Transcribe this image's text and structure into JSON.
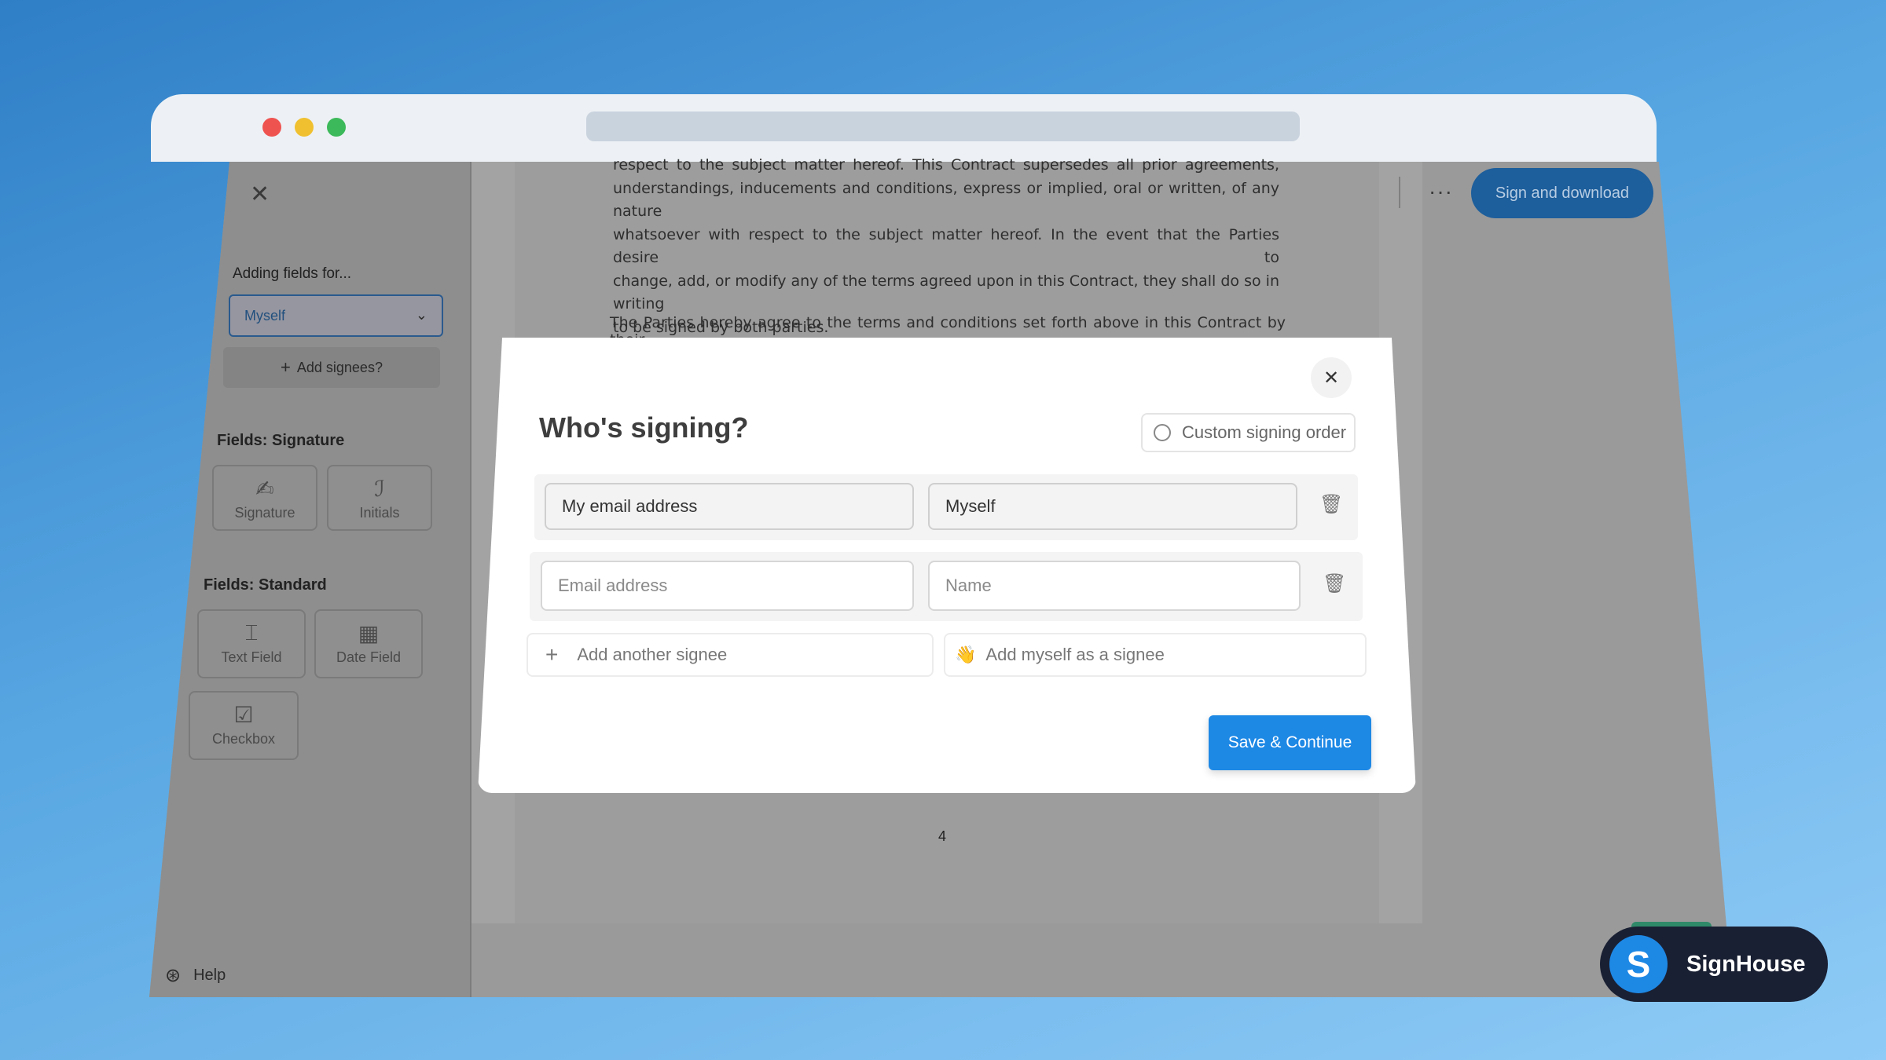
{
  "sidebar": {
    "adding_fields_label": "Adding fields for...",
    "selected_signee": "Myself",
    "add_signees_label": "Add signees?",
    "signature_section_title": "Fields: Signature",
    "signature_fields": [
      {
        "label": "Signature",
        "icon": "signature-icon"
      },
      {
        "label": "Initials",
        "icon": "initials-icon"
      }
    ],
    "standard_section_title": "Fields: Standard",
    "standard_fields": [
      {
        "label": "Text Field",
        "icon": "text-field-icon"
      },
      {
        "label": "Date Field",
        "icon": "calendar-icon"
      },
      {
        "label": "Checkbox",
        "icon": "checkbox-icon"
      }
    ],
    "help_label": "Help"
  },
  "document": {
    "paragraph1_lines": [
      "respect to the subject matter hereof. This Contract supersedes all prior agreements,",
      "understandings, inducements and conditions, express or implied, oral or written, of any nature",
      "whatsoever with respect to the subject matter hereof. In the event that the Parties desire to",
      "change, add, or modify any of the terms agreed upon in this Contract, they shall do so in writing",
      "to be signed by both parties."
    ],
    "paragraph2": "The Parties hereby agree to the terms and conditions set forth above in this Contract by their",
    "page_number": "4"
  },
  "header": {
    "sign_button_label": "Sign and download",
    "more_label": "···"
  },
  "modal": {
    "title": "Who's signing?",
    "custom_order_label": "Custom signing order",
    "signees": [
      {
        "email": "My email address",
        "name": "Myself"
      },
      {
        "email_placeholder": "Email address",
        "name_placeholder": "Name"
      }
    ],
    "add_another_label": "Add another signee",
    "add_myself_label": "Add myself as a signee",
    "add_myself_emoji": "👋",
    "save_label": "Save & Continue"
  },
  "brand": {
    "logo_letter": "S",
    "name": "SignHouse"
  },
  "colors": {
    "accent": "#1e88e5",
    "brand_dark": "#1a2033",
    "traffic_red": "#ef5350",
    "traffic_yellow": "#f0c030",
    "traffic_green": "#3cb95a"
  }
}
